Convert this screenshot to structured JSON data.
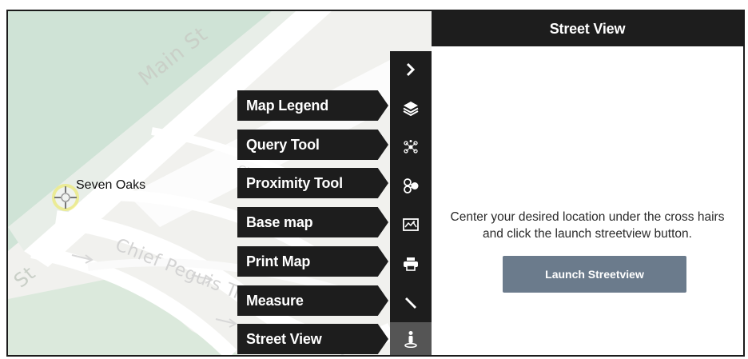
{
  "map": {
    "street_labels": {
      "main_st": "Main St",
      "st_left": "St",
      "chief_peguis": "Chief Peguis Trail",
      "faint_mid": "Chi"
    },
    "poi": "Seven Oaks"
  },
  "tools": [
    {
      "label": "Map Legend",
      "icon": "layers-icon"
    },
    {
      "label": "Query Tool",
      "icon": "molecule-icon"
    },
    {
      "label": "Proximity Tool",
      "icon": "proximity-icon"
    },
    {
      "label": "Base map",
      "icon": "basemap-icon"
    },
    {
      "label": "Print Map",
      "icon": "printer-icon"
    },
    {
      "label": "Measure",
      "icon": "ruler-icon"
    },
    {
      "label": "Street View",
      "icon": "pegman-icon"
    }
  ],
  "toolbar": {
    "collapse_icon": "chevron-right-icon",
    "active_tool": "Street View"
  },
  "panel": {
    "title": "Street View",
    "instruction_line1": "Center your desired location under the cross hairs",
    "instruction_line2": "and click the launch streetview button.",
    "launch_button": "Launch Streetview"
  },
  "colors": {
    "dark": "#1d1d1d",
    "active": "#555555",
    "button": "#6b7b8c",
    "park_green": "#cfe3d6",
    "crosshair": "#f2e600"
  }
}
